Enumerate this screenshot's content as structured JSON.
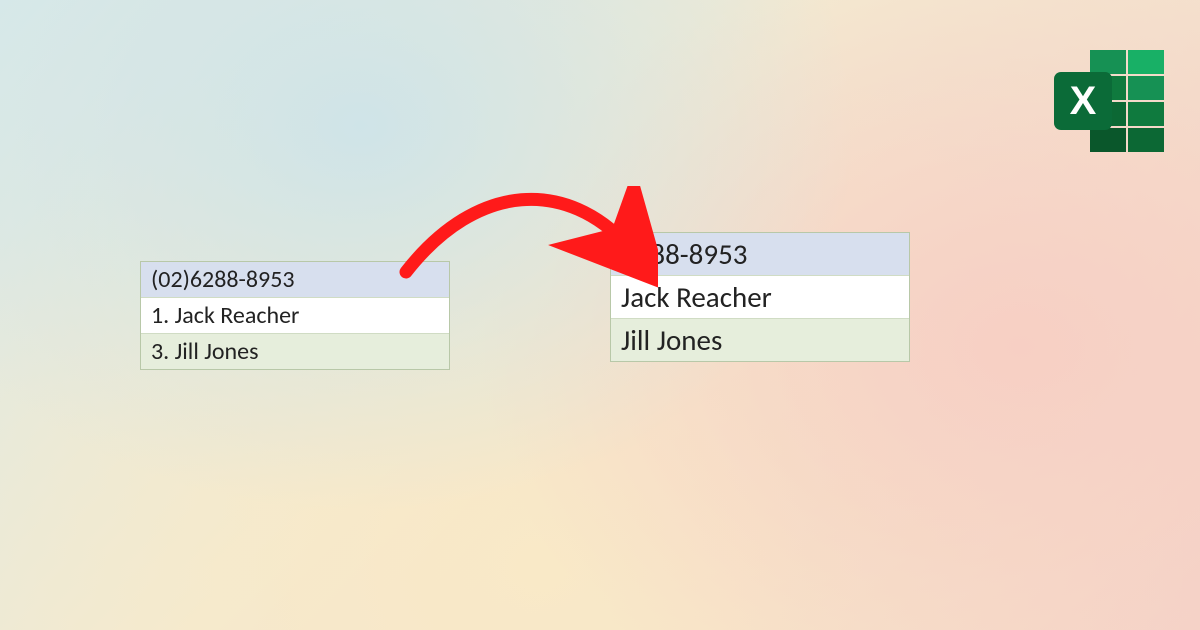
{
  "left_table": {
    "rows": [
      {
        "text": "(02)6288-8953",
        "bg": "blue"
      },
      {
        "text": "1. Jack Reacher",
        "bg": "white"
      },
      {
        "text": "3. Jill Jones",
        "bg": "green"
      }
    ]
  },
  "right_table": {
    "rows": [
      {
        "text": "6288-8953",
        "bg": "blue"
      },
      {
        "text": "Jack Reacher",
        "bg": "white"
      },
      {
        "text": "Jill Jones",
        "bg": "green"
      }
    ]
  },
  "icons": {
    "excel_letter": "X"
  }
}
